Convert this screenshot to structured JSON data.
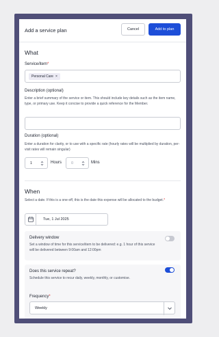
{
  "modal": {
    "title": "Add a service plan",
    "cancel_label": "Cancel",
    "submit_label": "Add to plan"
  },
  "what": {
    "heading": "What",
    "service_item": {
      "label": "Service/item",
      "required_mark": "*",
      "selected": [
        {
          "label": "Personal Care",
          "remove": "×"
        }
      ]
    },
    "description": {
      "label": "Description (optional)",
      "help": "Enter a brief summary of the service or item. This should include key details such as the item name, type, or primary use. Keep it concise to provide a quick reference for the Member.",
      "value": ""
    },
    "duration": {
      "label": "Duration (optional)",
      "help": "Enter a duration for clarity, or to use with a specific rate (hourly rates will be multiplied by duration, per-visit rates will remain singular)",
      "hours_value": "1",
      "hours_unit": "Hours",
      "mins_placeholder": "0",
      "mins_unit": "Mins"
    }
  },
  "when": {
    "heading": "When",
    "help": "Select a date. If this is a one-off, this is the date this expense will be allocated to the budget.",
    "required_mark": "*",
    "date_value": "Tue, 1 Jul 2025",
    "delivery_window": {
      "title": "Delivery window",
      "help": "Set a window of time for this service/item to be delivered: e.g. 1 hour of this service will be delivered between 9:00am and 12:00pm",
      "enabled": false
    },
    "repeat": {
      "title": "Does this service repeat?",
      "help": "Schedule this service to recur daily, weekly, monthly, or customise.",
      "enabled": true,
      "frequency_label": "Frequency",
      "required_mark": "*",
      "frequency_value": "Weekly"
    }
  },
  "colors": {
    "frame": "#4f4e78",
    "primary": "#1d4ed8",
    "chip": "#ecebf4",
    "toggle_off": "#c7c9d1"
  },
  "icons": [
    "stepper-icon",
    "calendar-icon",
    "chevron-down-icon",
    "close-icon"
  ]
}
